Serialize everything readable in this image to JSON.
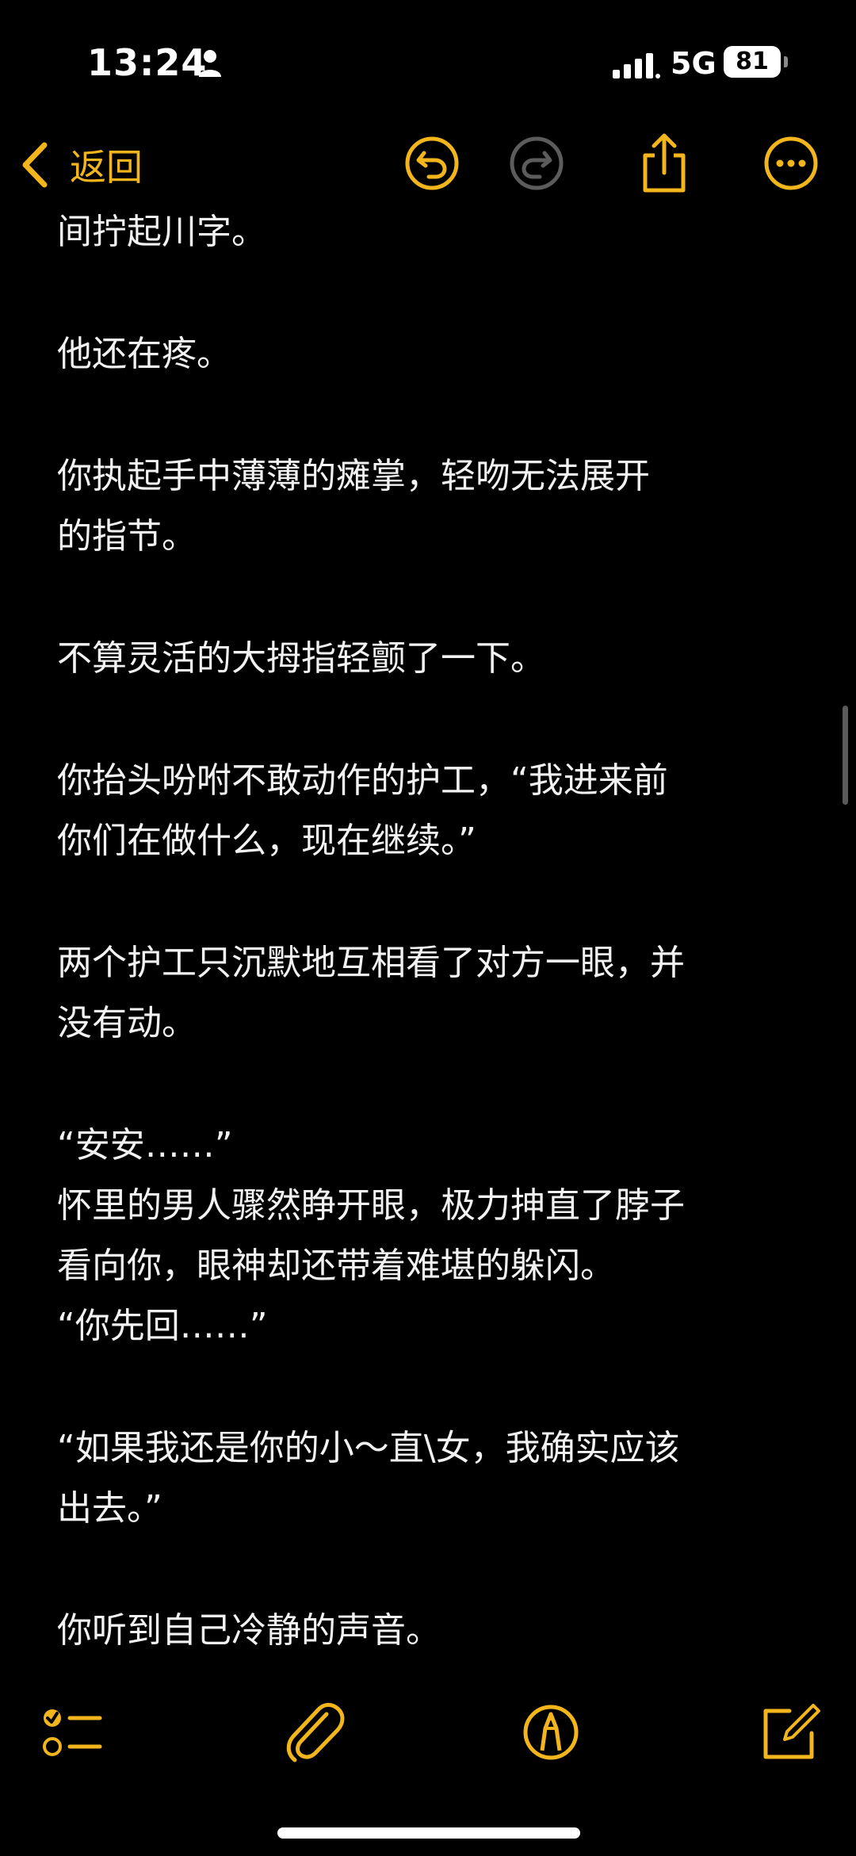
{
  "status_bar": {
    "time": "13:24",
    "network": "5G",
    "battery": "81"
  },
  "nav": {
    "back_label": "返回"
  },
  "note": {
    "lines": [
      "间拧起川字。",
      "",
      "他还在疼。",
      "",
      "你执起手中薄薄的瘫掌，轻吻无法展开",
      "的指节。",
      "",
      "不算灵活的大拇指轻颤了一下。",
      "",
      "你抬头吩咐不敢动作的护工，“我进来前",
      "你们在做什么，现在继续。”",
      "",
      "两个护工只沉默地互相看了对方一眼，并",
      "没有动。",
      "",
      "“安安……”",
      "怀里的男人骤然睁开眼，极力抻直了脖子",
      "看向你，眼神却还带着难堪的躲闪。",
      "“你先回……”",
      "",
      "“如果我还是你的小～直\\女，我确实应该",
      "出去。”",
      "",
      "你听到自己冷静的声音。"
    ]
  },
  "colors": {
    "accent": "#f2b51c",
    "background": "#000000",
    "text": "#f2f2f2",
    "disabled": "#5c5c5c"
  },
  "icons": {
    "nav": [
      "chevron-left-icon",
      "undo-icon",
      "redo-icon",
      "share-icon",
      "more-icon"
    ],
    "toolbar": [
      "checklist-icon",
      "attachment-icon",
      "markup-icon",
      "compose-icon"
    ]
  }
}
